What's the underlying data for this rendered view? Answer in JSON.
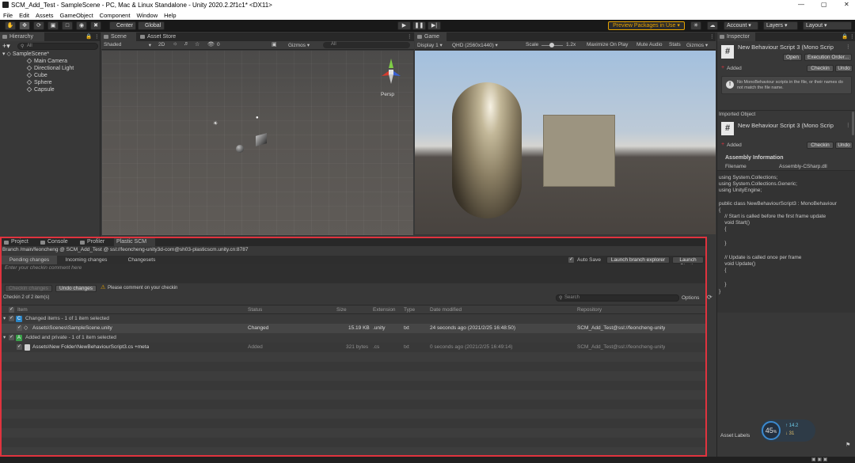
{
  "window": {
    "title": "SCM_Add_Test - SampleScene - PC, Mac & Linux Standalone - Unity 2020.2.2f1c1* <DX11>"
  },
  "menu": [
    "File",
    "Edit",
    "Assets",
    "GameObject",
    "Component",
    "Window",
    "Help"
  ],
  "toolbar": {
    "pivot_center": "Center",
    "pivot_global": "Global",
    "preview_packages": "Preview Packages in Use",
    "account": "Account",
    "layers": "Layers",
    "layout": "Layout"
  },
  "hierarchy": {
    "tab": "Hierarchy",
    "search_placeholder": "All",
    "scene": "SampleScene*",
    "items": [
      "Main Camera",
      "Directional Light",
      "Cube",
      "Sphere",
      "Capsule"
    ]
  },
  "scene_view": {
    "tab_scene": "Scene",
    "tab_asset_store": "Asset Store",
    "shading": "Shaded",
    "mode_2d": "2D",
    "fx_count": "0",
    "gizmos": "Gizmos",
    "gizmo_search": "All",
    "persp": "Persp"
  },
  "game_view": {
    "tab": "Game",
    "display": "Display 1",
    "resolution": "QHD (2560x1440)",
    "scale_label": "Scale",
    "scale_value": "1.2x",
    "maximize": "Maximize On Play",
    "mute": "Mute Audio",
    "stats": "Stats",
    "gizmos": "Gizmos"
  },
  "plastic": {
    "tabs": [
      "Project",
      "Console",
      "Profiler",
      "Plastic SCM"
    ],
    "branch": "Branch /main/feoncheng @ SCM_Add_Test @ ssl://feoncheng-unity3d-com@sh03-plasticscm.unity.cn:8787",
    "subtabs": [
      "Pending changes",
      "Incoming changes",
      "Changesets"
    ],
    "auto_save": "Auto Save",
    "launch_branch_explorer": "Launch branch explorer",
    "launch_plastic": "Launch Plastic",
    "comment_placeholder": "Enter your checkin comment here",
    "checkin_button": "Checkin changes",
    "undo_button": "Undo changes",
    "warning": "Please comment on your checkin",
    "selection_count": "Checkin 2 of 2 item(s)",
    "search_placeholder": "Search",
    "options": "Options",
    "columns": [
      "Item",
      "Status",
      "Size",
      "Extension",
      "Type",
      "Date modified",
      "Repository"
    ],
    "groups": [
      {
        "label": "Changed items - 1 of 1 item selected",
        "badge": "C",
        "color": "#2a86c8",
        "rows": [
          {
            "item": "Assets\\Scenes\\SampleScene.unity",
            "status": "Changed",
            "size": "15.19 KB",
            "ext": ".unity",
            "type": "txt",
            "date": "24 seconds ago (2021/2/25 16:48:50)",
            "repo": "SCM_Add_Test@ssl://feoncheng-unity"
          }
        ]
      },
      {
        "label": "Added and private - 1 of 1 item selected",
        "badge": "A",
        "color": "#3aa14a",
        "rows": [
          {
            "item": "Assets\\New Folder\\NewBehaviourScript3.cs +meta",
            "status": "Added",
            "size": "321 bytes",
            "ext": ".cs",
            "type": "txt",
            "date": "0 seconds ago (2021/2/25 16:49:14)",
            "repo": "SCM_Add_Test@ssl://feoncheng-unity"
          }
        ]
      }
    ]
  },
  "inspector": {
    "tab": "Inspector",
    "title": "New Behaviour Script 3 (Mono Scrip",
    "open": "Open",
    "execution_order": "Execution Order...",
    "added": "Added",
    "checkin": "Checkin",
    "undo": "Undo",
    "info": "No MonoBehaviour scripts in the file, or their names do not match the file name.",
    "imported_object": "Imported Object",
    "title2": "New Behaviour Script 3 (Mono Scrip",
    "assembly_info": "Assembly Information",
    "filename_label": "Filename",
    "filename_value": "Assembly-CSharp.dll",
    "code": [
      "using System.Collections;",
      "using System.Collections.Generic;",
      "using UnityEngine;",
      "",
      "public class NewBehaviourScript3 : MonoBehaviour",
      "{",
      "    // Start is called before the first frame update",
      "    void Start()",
      "    {",
      "",
      "    }",
      "",
      "    // Update is called once per frame",
      "    void Update()",
      "    {",
      "",
      "    }",
      "}"
    ],
    "asset_labels": "Asset Labels",
    "cpu_percent": "45",
    "net_up": "14.2",
    "net_down": "31"
  },
  "colors": {
    "accent_orange": "#e5a200",
    "highlight_red": "#e0333e",
    "selection": "#2c5d87"
  }
}
